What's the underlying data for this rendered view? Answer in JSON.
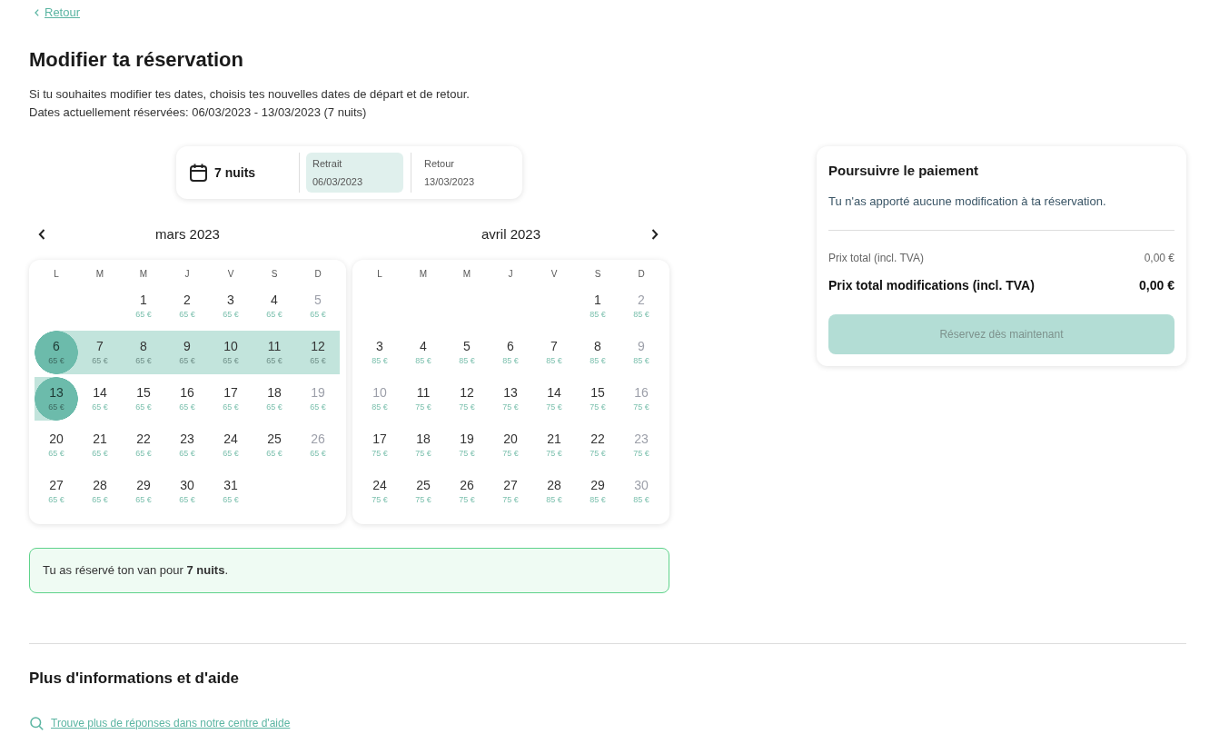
{
  "back_link": {
    "label": "Retour"
  },
  "title": "Modifier ta réservation",
  "intro": [
    "Si tu souhaites modifier tes dates, choisis tes nouvelles dates de départ et de retour.",
    "Dates actuellement réservées: 06/03/2023 - 13/03/2023 (7 nuits)"
  ],
  "date_selector": {
    "nights": "7 nuits",
    "fields": [
      {
        "label": "Retrait",
        "value": "06/03/2023",
        "selected": true
      },
      {
        "label": "Retour",
        "value": "13/03/2023",
        "selected": false
      }
    ]
  },
  "calendar": {
    "months": [
      {
        "title": "mars 2023",
        "weekdays": [
          "L",
          "M",
          "M",
          "J",
          "V",
          "S",
          "D"
        ],
        "weeks": [
          {
            "days": [
              {
                "kind": "blank"
              },
              {
                "kind": "blank"
              },
              {
                "kind": "day",
                "day": "1",
                "price": "65 €",
                "disabled": false,
                "selected": false,
                "in_range": false
              },
              {
                "kind": "day",
                "day": "2",
                "price": "65 €",
                "disabled": false,
                "selected": false,
                "in_range": false
              },
              {
                "kind": "day",
                "day": "3",
                "price": "65 €",
                "disabled": false,
                "selected": false,
                "in_range": false
              },
              {
                "kind": "day",
                "day": "4",
                "price": "65 €",
                "disabled": false,
                "selected": false,
                "in_range": false
              },
              {
                "kind": "day",
                "day": "5",
                "price": "65 €",
                "disabled": true,
                "selected": false,
                "in_range": false
              }
            ]
          },
          {
            "days": [
              {
                "kind": "day",
                "day": "6",
                "price": "65 €",
                "disabled": false,
                "selected": true,
                "in_range": true
              },
              {
                "kind": "day",
                "day": "7",
                "price": "65 €",
                "disabled": false,
                "selected": false,
                "in_range": true
              },
              {
                "kind": "day",
                "day": "8",
                "price": "65 €",
                "disabled": false,
                "selected": false,
                "in_range": true
              },
              {
                "kind": "day",
                "day": "9",
                "price": "65 €",
                "disabled": false,
                "selected": false,
                "in_range": true
              },
              {
                "kind": "day",
                "day": "10",
                "price": "65 €",
                "disabled": false,
                "selected": false,
                "in_range": true
              },
              {
                "kind": "day",
                "day": "11",
                "price": "65 €",
                "disabled": false,
                "selected": false,
                "in_range": true
              },
              {
                "kind": "day",
                "day": "12",
                "price": "65 €",
                "disabled": false,
                "selected": false,
                "in_range": true
              }
            ]
          },
          {
            "days": [
              {
                "kind": "day",
                "day": "13",
                "price": "65 €",
                "disabled": false,
                "selected": true,
                "in_range": true
              },
              {
                "kind": "day",
                "day": "14",
                "price": "65 €",
                "disabled": false,
                "selected": false,
                "in_range": false
              },
              {
                "kind": "day",
                "day": "15",
                "price": "65 €",
                "disabled": false,
                "selected": false,
                "in_range": false
              },
              {
                "kind": "day",
                "day": "16",
                "price": "65 €",
                "disabled": false,
                "selected": false,
                "in_range": false
              },
              {
                "kind": "day",
                "day": "17",
                "price": "65 €",
                "disabled": false,
                "selected": false,
                "in_range": false
              },
              {
                "kind": "day",
                "day": "18",
                "price": "65 €",
                "disabled": false,
                "selected": false,
                "in_range": false
              },
              {
                "kind": "day",
                "day": "19",
                "price": "65 €",
                "disabled": true,
                "selected": false,
                "in_range": false
              }
            ]
          },
          {
            "days": [
              {
                "kind": "day",
                "day": "20",
                "price": "65 €",
                "disabled": false,
                "selected": false,
                "in_range": false
              },
              {
                "kind": "day",
                "day": "21",
                "price": "65 €",
                "disabled": false,
                "selected": false,
                "in_range": false
              },
              {
                "kind": "day",
                "day": "22",
                "price": "65 €",
                "disabled": false,
                "selected": false,
                "in_range": false
              },
              {
                "kind": "day",
                "day": "23",
                "price": "65 €",
                "disabled": false,
                "selected": false,
                "in_range": false
              },
              {
                "kind": "day",
                "day": "24",
                "price": "65 €",
                "disabled": false,
                "selected": false,
                "in_range": false
              },
              {
                "kind": "day",
                "day": "25",
                "price": "65 €",
                "disabled": false,
                "selected": false,
                "in_range": false
              },
              {
                "kind": "day",
                "day": "26",
                "price": "65 €",
                "disabled": true,
                "selected": false,
                "in_range": false
              }
            ]
          },
          {
            "days": [
              {
                "kind": "day",
                "day": "27",
                "price": "65 €",
                "disabled": false,
                "selected": false,
                "in_range": false
              },
              {
                "kind": "day",
                "day": "28",
                "price": "65 €",
                "disabled": false,
                "selected": false,
                "in_range": false
              },
              {
                "kind": "day",
                "day": "29",
                "price": "65 €",
                "disabled": false,
                "selected": false,
                "in_range": false
              },
              {
                "kind": "day",
                "day": "30",
                "price": "65 €",
                "disabled": false,
                "selected": false,
                "in_range": false
              },
              {
                "kind": "day",
                "day": "31",
                "price": "65 €",
                "disabled": false,
                "selected": false,
                "in_range": false
              }
            ]
          }
        ]
      },
      {
        "title": "avril 2023",
        "weekdays": [
          "L",
          "M",
          "M",
          "J",
          "V",
          "S",
          "D"
        ],
        "weeks": [
          {
            "days": [
              {
                "kind": "blank"
              },
              {
                "kind": "blank"
              },
              {
                "kind": "blank"
              },
              {
                "kind": "blank"
              },
              {
                "kind": "blank"
              },
              {
                "kind": "day",
                "day": "1",
                "price": "85 €",
                "disabled": false,
                "selected": false,
                "in_range": false
              },
              {
                "kind": "day",
                "day": "2",
                "price": "85 €",
                "disabled": true,
                "selected": false,
                "in_range": false
              }
            ]
          },
          {
            "days": [
              {
                "kind": "day",
                "day": "3",
                "price": "85 €",
                "disabled": false,
                "selected": false,
                "in_range": false
              },
              {
                "kind": "day",
                "day": "4",
                "price": "85 €",
                "disabled": false,
                "selected": false,
                "in_range": false
              },
              {
                "kind": "day",
                "day": "5",
                "price": "85 €",
                "disabled": false,
                "selected": false,
                "in_range": false
              },
              {
                "kind": "day",
                "day": "6",
                "price": "85 €",
                "disabled": false,
                "selected": false,
                "in_range": false
              },
              {
                "kind": "day",
                "day": "7",
                "price": "85 €",
                "disabled": false,
                "selected": false,
                "in_range": false
              },
              {
                "kind": "day",
                "day": "8",
                "price": "85 €",
                "disabled": false,
                "selected": false,
                "in_range": false
              },
              {
                "kind": "day",
                "day": "9",
                "price": "85 €",
                "disabled": true,
                "selected": false,
                "in_range": false
              }
            ]
          },
          {
            "days": [
              {
                "kind": "day",
                "day": "10",
                "price": "85 €",
                "disabled": true,
                "selected": false,
                "in_range": false
              },
              {
                "kind": "day",
                "day": "11",
                "price": "75 €",
                "disabled": false,
                "selected": false,
                "in_range": false
              },
              {
                "kind": "day",
                "day": "12",
                "price": "75 €",
                "disabled": false,
                "selected": false,
                "in_range": false
              },
              {
                "kind": "day",
                "day": "13",
                "price": "75 €",
                "disabled": false,
                "selected": false,
                "in_range": false
              },
              {
                "kind": "day",
                "day": "14",
                "price": "75 €",
                "disabled": false,
                "selected": false,
                "in_range": false
              },
              {
                "kind": "day",
                "day": "15",
                "price": "75 €",
                "disabled": false,
                "selected": false,
                "in_range": false
              },
              {
                "kind": "day",
                "day": "16",
                "price": "75 €",
                "disabled": true,
                "selected": false,
                "in_range": false
              }
            ]
          },
          {
            "days": [
              {
                "kind": "day",
                "day": "17",
                "price": "75 €",
                "disabled": false,
                "selected": false,
                "in_range": false
              },
              {
                "kind": "day",
                "day": "18",
                "price": "75 €",
                "disabled": false,
                "selected": false,
                "in_range": false
              },
              {
                "kind": "day",
                "day": "19",
                "price": "75 €",
                "disabled": false,
                "selected": false,
                "in_range": false
              },
              {
                "kind": "day",
                "day": "20",
                "price": "75 €",
                "disabled": false,
                "selected": false,
                "in_range": false
              },
              {
                "kind": "day",
                "day": "21",
                "price": "75 €",
                "disabled": false,
                "selected": false,
                "in_range": false
              },
              {
                "kind": "day",
                "day": "22",
                "price": "75 €",
                "disabled": false,
                "selected": false,
                "in_range": false
              },
              {
                "kind": "day",
                "day": "23",
                "price": "75 €",
                "disabled": true,
                "selected": false,
                "in_range": false
              }
            ]
          },
          {
            "days": [
              {
                "kind": "day",
                "day": "24",
                "price": "75 €",
                "disabled": false,
                "selected": false,
                "in_range": false
              },
              {
                "kind": "day",
                "day": "25",
                "price": "75 €",
                "disabled": false,
                "selected": false,
                "in_range": false
              },
              {
                "kind": "day",
                "day": "26",
                "price": "75 €",
                "disabled": false,
                "selected": false,
                "in_range": false
              },
              {
                "kind": "day",
                "day": "27",
                "price": "75 €",
                "disabled": false,
                "selected": false,
                "in_range": false
              },
              {
                "kind": "day",
                "day": "28",
                "price": "85 €",
                "disabled": false,
                "selected": false,
                "in_range": false
              },
              {
                "kind": "day",
                "day": "29",
                "price": "85 €",
                "disabled": false,
                "selected": false,
                "in_range": false
              },
              {
                "kind": "day",
                "day": "30",
                "price": "85 €",
                "disabled": true,
                "selected": false,
                "in_range": false
              }
            ]
          }
        ]
      }
    ]
  },
  "notice": "Tu as réservé ton van pour **7 nuits**.",
  "payment": {
    "title": "Poursuivre le paiement",
    "message": "Tu n'as apporté aucune modification à ta réservation.",
    "rows": [
      {
        "kind": "subtotal",
        "label": "Prix total (incl. TVA)",
        "value": "0,00 €"
      },
      {
        "kind": "total",
        "label": "Prix total modifications (incl. TVA)",
        "value": "0,00 €"
      }
    ],
    "button": {
      "label": "Réservez dès maintenant",
      "disabled": true
    }
  },
  "help": {
    "title": "Plus d'informations et d'aide",
    "link": "Trouve plus de réponses dans notre centre d'aide"
  }
}
